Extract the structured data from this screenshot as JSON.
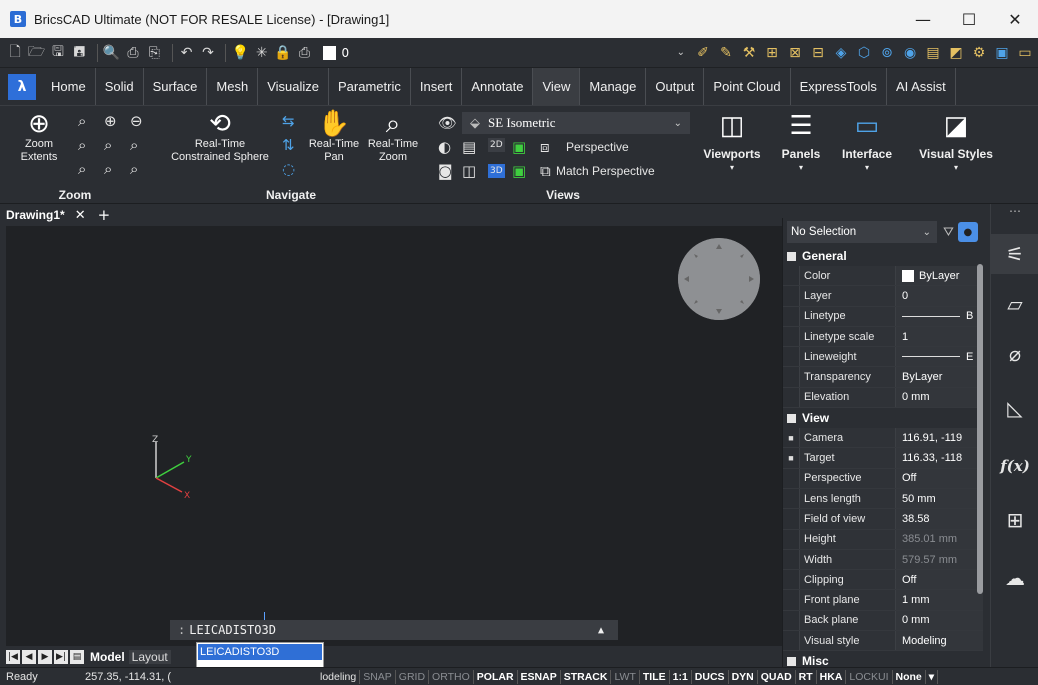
{
  "window": {
    "title": "BricsCAD Ultimate (NOT FOR RESALE License) - [Drawing1]",
    "app_icon": "bricscad-logo-icon",
    "minimize": "—",
    "maximize": "☐",
    "close": "✕"
  },
  "qat": {
    "layer_value": "0"
  },
  "ribbon_tabs": [
    "Home",
    "Solid",
    "Surface",
    "Mesh",
    "Visualize",
    "Parametric",
    "Insert",
    "Annotate",
    "View",
    "Manage",
    "Output",
    "Point Cloud",
    "ExpressTools",
    "AI Assist"
  ],
  "ribbon": {
    "zoom": {
      "title": "Zoom",
      "extents_line1": "Zoom",
      "extents_line2": "Extents"
    },
    "navigate": {
      "title": "Navigate",
      "sphere_line1": "Real-Time",
      "sphere_line2": "Constrained Sphere",
      "pan_line1": "Real-Time",
      "pan_line2": "Pan",
      "zoom_line1": "Real-Time",
      "zoom_line2": "Zoom"
    },
    "views": {
      "title": "Views",
      "view_combo": "SE Isometric",
      "perspective": "Perspective",
      "match_perspective": "Match Perspective",
      "btn_2d": "2D",
      "btn_3d": "3D"
    },
    "viewports": "Viewports",
    "panels": "Panels",
    "interface": "Interface",
    "visual_styles": "Visual Styles"
  },
  "doc_tabs": {
    "active": "Drawing1*",
    "close": "✕",
    "add": "+"
  },
  "ucs": {
    "x": "X",
    "y": "Y",
    "z": "Z"
  },
  "command_line": {
    "prompt": ":",
    "text": "LEICADISTO3D",
    "autocomplete": [
      "LEICADISTO3D"
    ]
  },
  "layout_tabs": {
    "model": "Model",
    "layout": "Layout"
  },
  "status_bar": {
    "ready": "Ready",
    "coords": "257.35, -114.31, (",
    "workspace_fragment": "lodeling",
    "toggles": [
      {
        "label": "SNAP",
        "on": false
      },
      {
        "label": "GRID",
        "on": false
      },
      {
        "label": "ORTHO",
        "on": false
      },
      {
        "label": "POLAR",
        "on": true
      },
      {
        "label": "ESNAP",
        "on": true
      },
      {
        "label": "STRACK",
        "on": true
      },
      {
        "label": "LWT",
        "on": false
      },
      {
        "label": "TILE",
        "on": true
      },
      {
        "label": "1:1",
        "on": true
      },
      {
        "label": "DUCS",
        "on": true
      },
      {
        "label": "DYN",
        "on": true
      },
      {
        "label": "QUAD",
        "on": true
      },
      {
        "label": "RT",
        "on": true
      },
      {
        "label": "HKA",
        "on": true
      },
      {
        "label": "LOCKUI",
        "on": false
      },
      {
        "label": "None",
        "on": true
      }
    ]
  },
  "properties": {
    "selection": "No Selection",
    "categories": {
      "general": "General",
      "view": "View",
      "misc": "Misc"
    },
    "general_rows": [
      {
        "name": "Color",
        "value": "ByLayer"
      },
      {
        "name": "Layer",
        "value": "0"
      },
      {
        "name": "Linetype",
        "value": "B"
      },
      {
        "name": "Linetype scale",
        "value": "1"
      },
      {
        "name": "Lineweight",
        "value": "E"
      },
      {
        "name": "Transparency",
        "value": "ByLayer"
      },
      {
        "name": "Elevation",
        "value": "0 mm"
      }
    ],
    "view_rows": [
      {
        "name": "Camera",
        "value": "116.91, -119"
      },
      {
        "name": "Target",
        "value": "116.33, -118"
      },
      {
        "name": "Perspective",
        "value": "Off"
      },
      {
        "name": "Lens length",
        "value": "50 mm"
      },
      {
        "name": "Field of view",
        "value": "38.58"
      },
      {
        "name": "Height",
        "value": "385.01 mm"
      },
      {
        "name": "Width",
        "value": "579.57 mm"
      },
      {
        "name": "Clipping",
        "value": "Off"
      },
      {
        "name": "Front plane",
        "value": "1 mm"
      },
      {
        "name": "Back plane",
        "value": "0 mm"
      },
      {
        "name": "Visual style",
        "value": "Modeling"
      }
    ]
  },
  "rail": {
    "fx_label": "f(x)"
  },
  "colors": {
    "accent": "#2f6fd6",
    "background": "#2b2e33",
    "canvas": "#202225",
    "ucs_z": "#d0d0d0",
    "ucs_y": "#3fcf3f",
    "ucs_x": "#e04040"
  }
}
